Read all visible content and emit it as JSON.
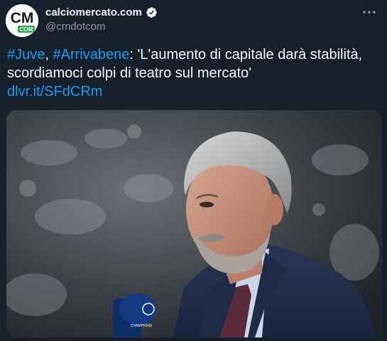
{
  "user": {
    "display_name": "calciomercato.com",
    "handle": "@cmdotcom",
    "avatar_text_top": "CM",
    "avatar_text_bottom": "COM"
  },
  "tweet": {
    "hashtag_1": "#Juve",
    "sep_1": ", ",
    "hashtag_2": "#Arrivabene",
    "body": ": 'L'aumento di capitale darà stabilità, scordiamoci colpi di teatro sul mercato'",
    "link": "dlvr.it/SFdCRm"
  },
  "media": {
    "mic_logo_text": "CHAMPIONS"
  },
  "colors": {
    "background": "#15202b",
    "text": "#f7f9f9",
    "secondary": "#8b98a5",
    "accent": "#1d9bf0"
  },
  "icons": {
    "verified": "verified-badge-icon",
    "more": "more-options-icon"
  }
}
